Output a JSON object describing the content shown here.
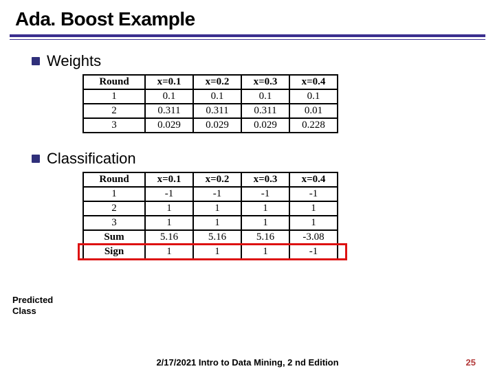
{
  "title": "Ada. Boost Example",
  "bullets": {
    "weights": "Weights",
    "classification": "Classification"
  },
  "weights_table": {
    "headers": [
      "Round",
      "x=0.1",
      "x=0.2",
      "x=0.3",
      "x=0.4"
    ],
    "rows": [
      [
        "1",
        "0.1",
        "0.1",
        "0.1",
        "0.1"
      ],
      [
        "2",
        "0.311",
        "0.311",
        "0.311",
        "0.01"
      ],
      [
        "3",
        "0.029",
        "0.029",
        "0.029",
        "0.228"
      ]
    ]
  },
  "class_table": {
    "headers": [
      "Round",
      "x=0.1",
      "x=0.2",
      "x=0.3",
      "x=0.4"
    ],
    "rows": [
      [
        "1",
        "-1",
        "-1",
        "-1",
        "-1"
      ],
      [
        "2",
        "1",
        "1",
        "1",
        "1"
      ],
      [
        "3",
        "1",
        "1",
        "1",
        "1"
      ]
    ],
    "sum": [
      "Sum",
      "5.16",
      "5.16",
      "5.16",
      "-3.08"
    ],
    "sign": [
      "Sign",
      "1",
      "1",
      "1",
      "-1"
    ]
  },
  "predicted_label_l1": "Predicted",
  "predicted_label_l2": "Class",
  "footer": {
    "center": "2/17/2021  Intro to Data Mining, 2 nd Edition",
    "page": "25"
  },
  "chart_data": [
    {
      "type": "table",
      "title": "Weights",
      "headers": [
        "Round",
        "x=0.1",
        "x=0.2",
        "x=0.3",
        "x=0.4"
      ],
      "rows": [
        {
          "Round": 1,
          "x=0.1": 0.1,
          "x=0.2": 0.1,
          "x=0.3": 0.1,
          "x=0.4": 0.1
        },
        {
          "Round": 2,
          "x=0.1": 0.311,
          "x=0.2": 0.311,
          "x=0.3": 0.311,
          "x=0.4": 0.01
        },
        {
          "Round": 3,
          "x=0.1": 0.029,
          "x=0.2": 0.029,
          "x=0.3": 0.029,
          "x=0.4": 0.228
        }
      ]
    },
    {
      "type": "table",
      "title": "Classification",
      "headers": [
        "Round",
        "x=0.1",
        "x=0.2",
        "x=0.3",
        "x=0.4"
      ],
      "rows": [
        {
          "Round": 1,
          "x=0.1": -1,
          "x=0.2": -1,
          "x=0.3": -1,
          "x=0.4": -1
        },
        {
          "Round": 2,
          "x=0.1": 1,
          "x=0.2": 1,
          "x=0.3": 1,
          "x=0.4": 1
        },
        {
          "Round": 3,
          "x=0.1": 1,
          "x=0.2": 1,
          "x=0.3": 1,
          "x=0.4": 1
        }
      ],
      "summary": {
        "Sum": {
          "x=0.1": 5.16,
          "x=0.2": 5.16,
          "x=0.3": 5.16,
          "x=0.4": -3.08
        },
        "Sign": {
          "x=0.1": 1,
          "x=0.2": 1,
          "x=0.3": 1,
          "x=0.4": -1
        }
      }
    }
  ]
}
